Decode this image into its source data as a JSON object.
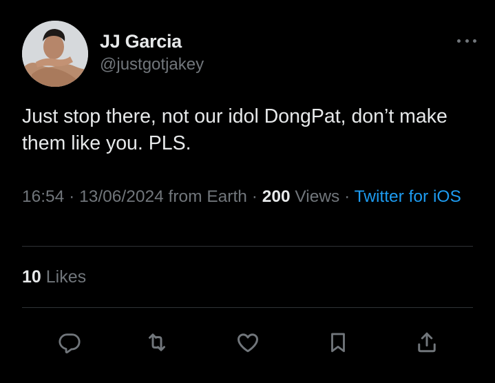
{
  "colors": {
    "background": "#000000",
    "primary_text": "#e7e9ea",
    "secondary_text": "#71767b",
    "link": "#1d9bf0",
    "divider": "#2f3336"
  },
  "author": {
    "display_name": "JJ Garcia",
    "handle": "@justgotjakey",
    "avatar_icon": "profile-photo"
  },
  "tweet": {
    "text": "Just stop there, not our idol DongPat, don’t make them like you. PLS."
  },
  "meta": {
    "time": "16:54",
    "sep1": " · ",
    "date": "13/06/2024",
    "location": " from Earth",
    "sep2": " · ",
    "views_count": "200",
    "views_label": " Views",
    "sep3": " · ",
    "source": "Twitter for iOS"
  },
  "stats": {
    "likes_count": "10",
    "likes_label": " Likes"
  },
  "actions": [
    {
      "icon": "reply-icon"
    },
    {
      "icon": "retweet-icon"
    },
    {
      "icon": "like-icon"
    },
    {
      "icon": "bookmark-icon"
    },
    {
      "icon": "share-icon"
    }
  ]
}
